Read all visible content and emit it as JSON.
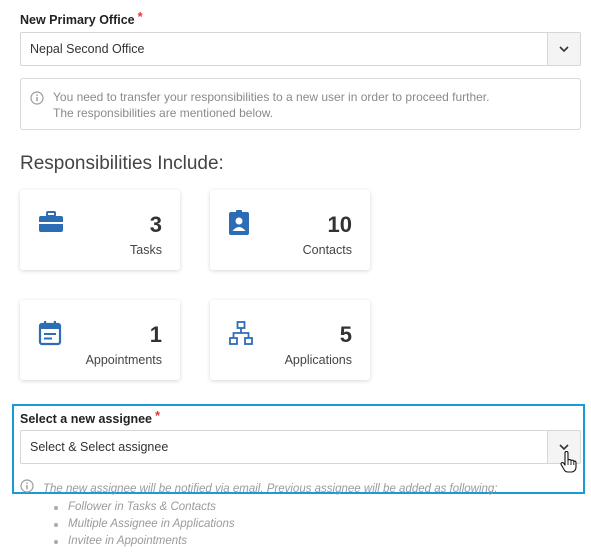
{
  "primary_office": {
    "label": "New Primary Office",
    "required_mark": "*",
    "value": "Nepal Second Office"
  },
  "info": {
    "line1": "You need to transfer your responsibilities to a new user in order to proceed further.",
    "line2": "The responsibilities are mentioned below."
  },
  "responsibilities": {
    "heading": "Responsibilities Include:",
    "accent_color": "#2d6db5",
    "cards": [
      {
        "icon": "briefcase-icon",
        "count": "3",
        "label": "Tasks"
      },
      {
        "icon": "contact-badge-icon",
        "count": "10",
        "label": "Contacts"
      },
      {
        "icon": "calendar-icon",
        "count": "1",
        "label": "Appointments"
      },
      {
        "icon": "workflow-icon",
        "count": "5",
        "label": "Applications"
      }
    ]
  },
  "assignee": {
    "label": "Select a new assignee",
    "required_mark": "*",
    "value": "Select & Select assignee",
    "note": "The new assignee will be notified via email. Previous assignee will be added as following:",
    "follow_items": [
      "Follower in Tasks & Contacts",
      "Multiple Assignee in Applications",
      "Invitee in Appointments"
    ]
  }
}
